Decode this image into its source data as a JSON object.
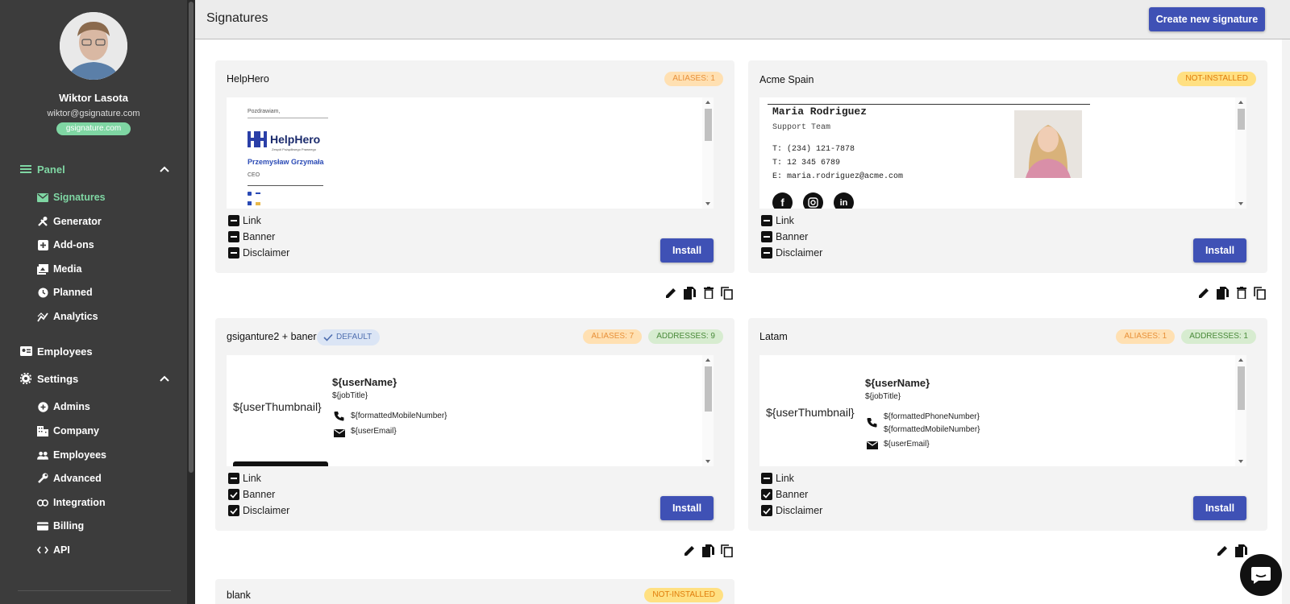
{
  "user": {
    "name": "Wiktor Lasota",
    "email": "wiktor@gsignature.com",
    "domain": "gsignature.com"
  },
  "nav": {
    "panel": "Panel",
    "panel_items": [
      "Signatures",
      "Generator",
      "Add-ons",
      "Media",
      "Planned",
      "Analytics"
    ],
    "employees": "Employees",
    "settings": "Settings",
    "settings_items": [
      "Admins",
      "Company",
      "Employees",
      "Advanced",
      "Integration",
      "Billing",
      "API"
    ]
  },
  "header": {
    "title": "Signatures",
    "create_label": "Create new signature"
  },
  "options": [
    "Link",
    "Banner",
    "Disclaimer"
  ],
  "install_label": "Install",
  "cards": [
    {
      "title": "HelpHero",
      "badges": [
        "ALIASES: 1"
      ],
      "checked": [
        false,
        false,
        false
      ],
      "preview": {
        "greeting": "Pozdrawiam,",
        "logo": "HelpHero",
        "logo_sub": "Zespół Pożądliwego Prawnego",
        "name": "Przemysław Grzymała",
        "role": "CEO"
      }
    },
    {
      "title": "Acme Spain",
      "badges": [
        "NOT-INSTALLED"
      ],
      "checked": [
        false,
        false,
        false
      ],
      "preview": {
        "name": "Maria Rodriguez",
        "team": "Support Team",
        "t1": "T: (234) 121-7878",
        "t2": "T: 12 345 6789",
        "email": "E: maria.rodriguez@acme.com"
      }
    },
    {
      "title": "gsiganture2 + baner",
      "default_label": "DEFAULT",
      "badges": [
        "ALIASES: 7",
        "ADDRESSES: 9"
      ],
      "checked": [
        false,
        true,
        true
      ],
      "preview": {
        "thumb": "${userThumbnail}",
        "name": "${userName}",
        "job": "${jobTitle}",
        "mobile": "${formattedMobileNumber}",
        "email": "${userEmail}"
      }
    },
    {
      "title": "Latam",
      "badges": [
        "ALIASES: 1",
        "ADDRESSES: 1"
      ],
      "checked": [
        false,
        true,
        true
      ],
      "preview": {
        "thumb": "${userThumbnail}",
        "name": "${userName}",
        "job": "${jobTitle}",
        "phone": "${formattedPhoneNumber}",
        "mobile": "${formattedMobileNumber}",
        "email": "${userEmail}"
      }
    },
    {
      "title": "blank",
      "badges": [
        "NOT-INSTALLED"
      ]
    }
  ],
  "colors": {
    "sidebar": "#3c3c3c",
    "accent": "#3f51b5",
    "active_nav": "#7fd6a3"
  }
}
